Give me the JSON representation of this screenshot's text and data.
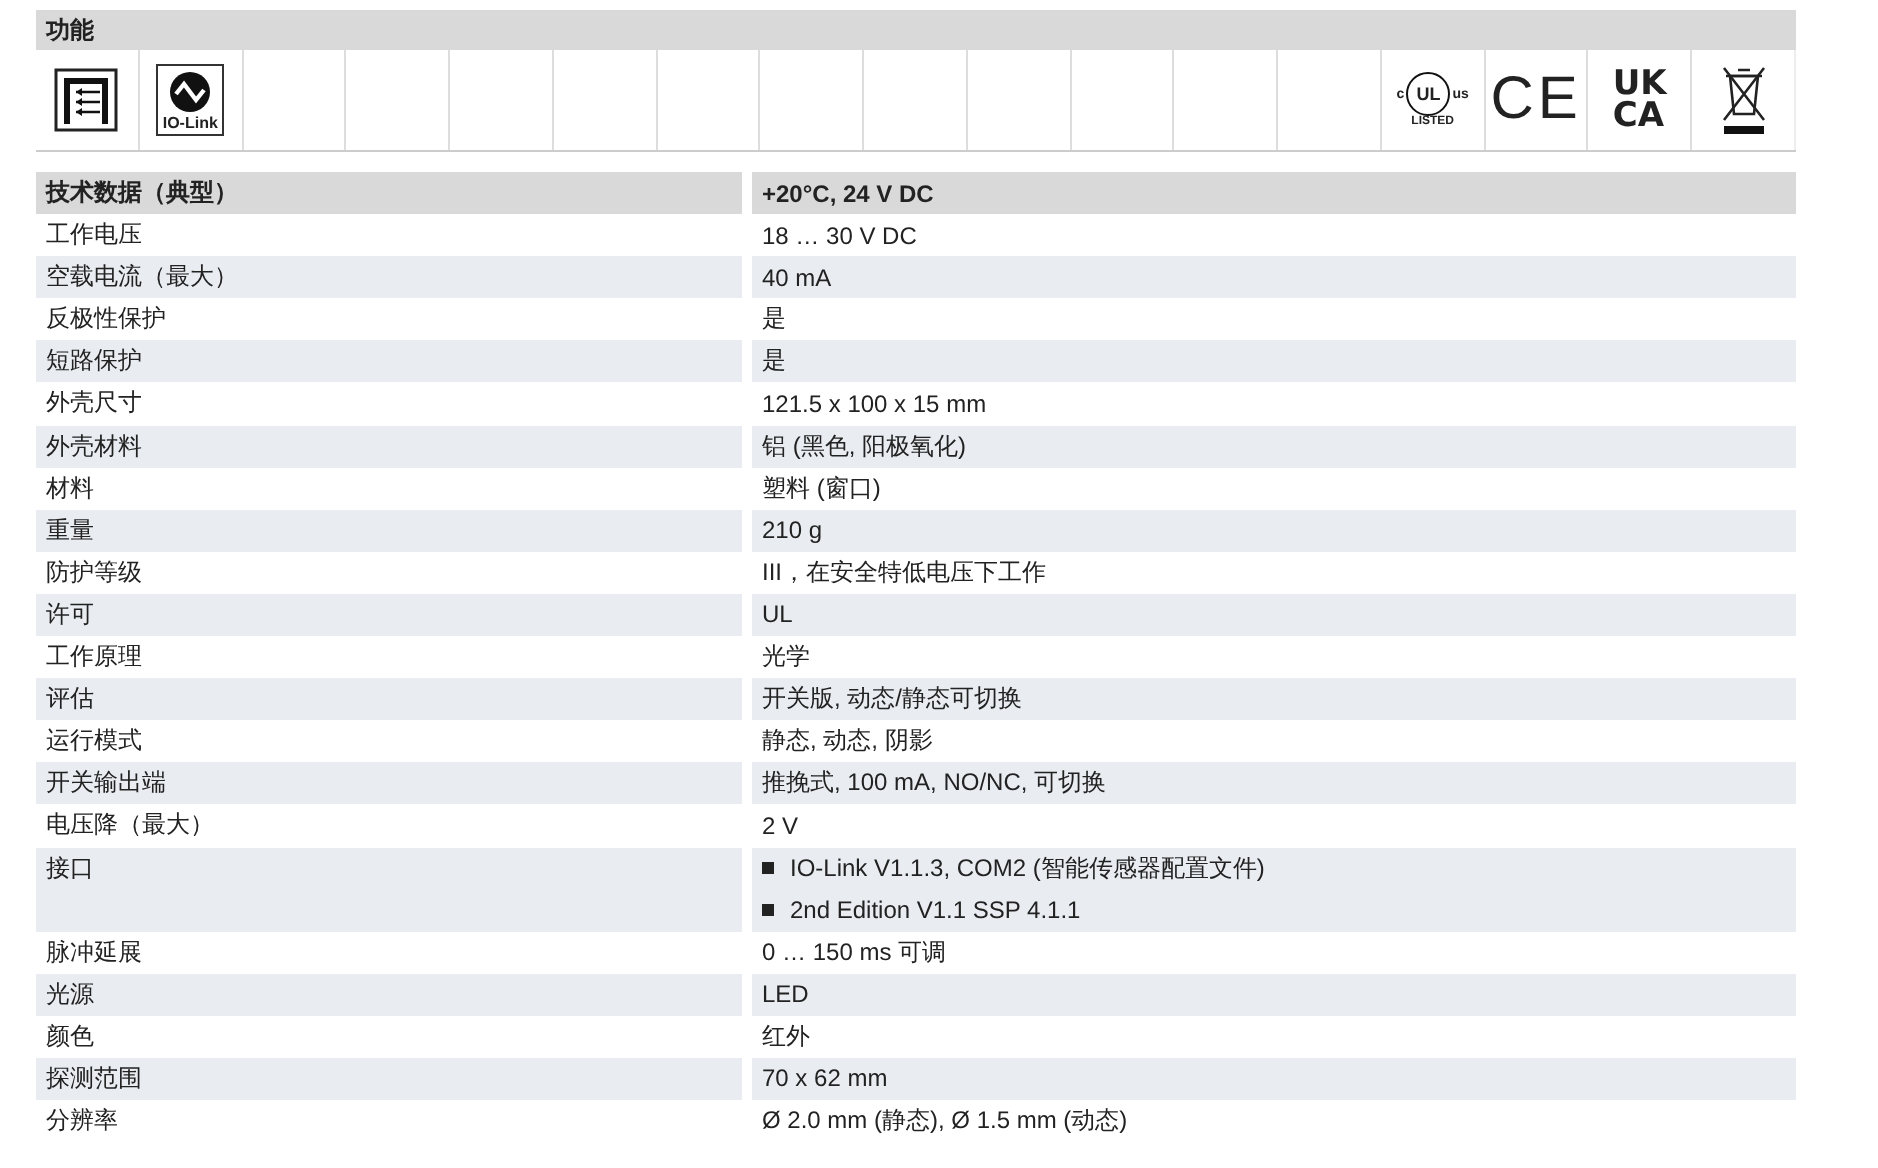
{
  "functions": {
    "title": "功能",
    "cells": [
      {
        "kind": "light-grid"
      },
      {
        "kind": "io-link",
        "label": "IO-Link"
      },
      {
        "kind": "empty"
      },
      {
        "kind": "empty"
      },
      {
        "kind": "empty"
      },
      {
        "kind": "empty"
      },
      {
        "kind": "empty"
      },
      {
        "kind": "empty"
      },
      {
        "kind": "empty"
      },
      {
        "kind": "empty"
      },
      {
        "kind": "empty"
      },
      {
        "kind": "empty"
      },
      {
        "kind": "empty"
      },
      {
        "kind": "ul",
        "left": "c",
        "mark": "UL",
        "right": "us",
        "label": "LISTED"
      },
      {
        "kind": "ce",
        "mark": "CE"
      },
      {
        "kind": "ukca",
        "top": "UK",
        "bottom": "CA"
      },
      {
        "kind": "weee"
      }
    ]
  },
  "specs": {
    "header": {
      "label": "技术数据（典型）",
      "value": "+20°C, 24 V DC"
    },
    "rows": [
      {
        "label": "工作电压",
        "values": [
          "18 … 30 V DC"
        ]
      },
      {
        "label": "空载电流（最大）",
        "values": [
          "40 mA"
        ]
      },
      {
        "label": "反极性保护",
        "values": [
          "是"
        ]
      },
      {
        "label": "短路保护",
        "values": [
          "是"
        ]
      },
      {
        "label": "外壳尺寸",
        "values": [
          "121.5 x 100 x 15 mm"
        ]
      },
      {
        "label": "外壳材料",
        "values": [
          "铝 (黑色, 阳极氧化)"
        ]
      },
      {
        "label": "材料",
        "values": [
          "塑料 (窗口)"
        ]
      },
      {
        "label": "重量",
        "values": [
          "210 g"
        ]
      },
      {
        "label": "防护等级",
        "values": [
          "III，在安全特低电压下工作"
        ]
      },
      {
        "label": "许可",
        "values": [
          "UL"
        ]
      },
      {
        "label": "工作原理",
        "values": [
          "光学"
        ]
      },
      {
        "label": "评估",
        "values": [
          "开关版, 动态/静态可切换"
        ]
      },
      {
        "label": "运行模式",
        "values": [
          "静态, 动态, 阴影"
        ]
      },
      {
        "label": "开关输出端",
        "values": [
          "推挽式, 100 mA, NO/NC, 可切换"
        ]
      },
      {
        "label": "电压降（最大）",
        "values": [
          "2 V"
        ]
      },
      {
        "label": "接口",
        "kind": "bullets",
        "values": [
          "IO-Link V1.1.3, COM2 (智能传感器配置文件)",
          "2nd Edition V1.1 SSP 4.1.1"
        ]
      },
      {
        "label": "脉冲延展",
        "values": [
          "0 … 150 ms 可调"
        ]
      },
      {
        "label": "光源",
        "values": [
          "LED"
        ]
      },
      {
        "label": "颜色",
        "values": [
          "红外"
        ]
      },
      {
        "label": "探测范围",
        "values": [
          "70 x 62 mm"
        ]
      },
      {
        "label": "分辨率",
        "values": [
          "Ø 2.0 mm (静态), Ø 1.5 mm (动态)"
        ]
      }
    ]
  }
}
